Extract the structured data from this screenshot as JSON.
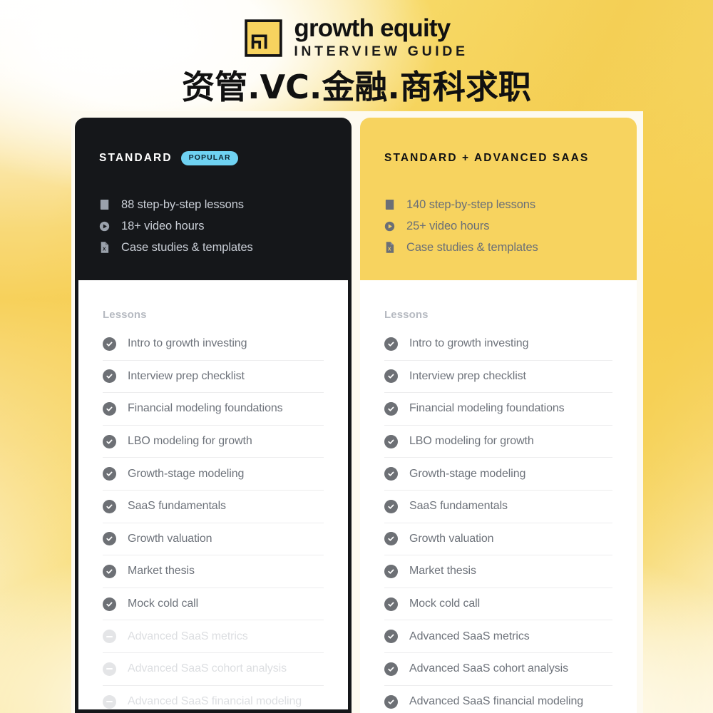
{
  "brand": {
    "logo_icon": "growth-equity-logo-mark",
    "title": "growth equity",
    "subtitle": "INTERVIEW GUIDE",
    "accent_color": "#f7d35f"
  },
  "headline": {
    "text": "资管.VC.金融.商科求职"
  },
  "plans": [
    {
      "id": "standard",
      "name": "STANDARD",
      "badge": "POPULAR",
      "badge_color": "#6fd2f2",
      "theme": "dark",
      "header_bg": "#15171a",
      "features": [
        {
          "icon": "book-icon",
          "text": "88 step-by-step lessons"
        },
        {
          "icon": "play-circle-icon",
          "text": "18+ video hours"
        },
        {
          "icon": "spreadsheet-icon",
          "text": "Case studies & templates"
        }
      ],
      "lessons_label": "Lessons",
      "lessons": [
        {
          "text": "Intro to growth investing",
          "included": true
        },
        {
          "text": "Interview prep checklist",
          "included": true
        },
        {
          "text": "Financial modeling foundations",
          "included": true
        },
        {
          "text": "LBO modeling for growth",
          "included": true
        },
        {
          "text": "Growth-stage modeling",
          "included": true
        },
        {
          "text": "SaaS fundamentals",
          "included": true
        },
        {
          "text": "Growth valuation",
          "included": true
        },
        {
          "text": "Market thesis",
          "included": true
        },
        {
          "text": "Mock cold call",
          "included": true
        },
        {
          "text": "Advanced SaaS metrics",
          "included": false
        },
        {
          "text": "Advanced SaaS cohort analysis",
          "included": false
        },
        {
          "text": "Advanced SaaS financial modeling",
          "included": false
        }
      ]
    },
    {
      "id": "standard-advanced-saas",
      "name": "STANDARD + ADVANCED SAAS",
      "badge": "",
      "badge_color": "",
      "theme": "yellow",
      "header_bg": "#f7d35f",
      "features": [
        {
          "icon": "book-icon",
          "text": "140 step-by-step lessons"
        },
        {
          "icon": "play-circle-icon",
          "text": "25+ video hours"
        },
        {
          "icon": "spreadsheet-icon",
          "text": "Case studies & templates"
        }
      ],
      "lessons_label": "Lessons",
      "lessons": [
        {
          "text": "Intro to growth investing",
          "included": true
        },
        {
          "text": "Interview prep checklist",
          "included": true
        },
        {
          "text": "Financial modeling foundations",
          "included": true
        },
        {
          "text": "LBO modeling for growth",
          "included": true
        },
        {
          "text": "Growth-stage modeling",
          "included": true
        },
        {
          "text": "SaaS fundamentals",
          "included": true
        },
        {
          "text": "Growth valuation",
          "included": true
        },
        {
          "text": "Market thesis",
          "included": true
        },
        {
          "text": "Mock cold call",
          "included": true
        },
        {
          "text": "Advanced SaaS metrics",
          "included": true
        },
        {
          "text": "Advanced SaaS cohort analysis",
          "included": true
        },
        {
          "text": "Advanced SaaS financial modeling",
          "included": true
        }
      ]
    }
  ]
}
